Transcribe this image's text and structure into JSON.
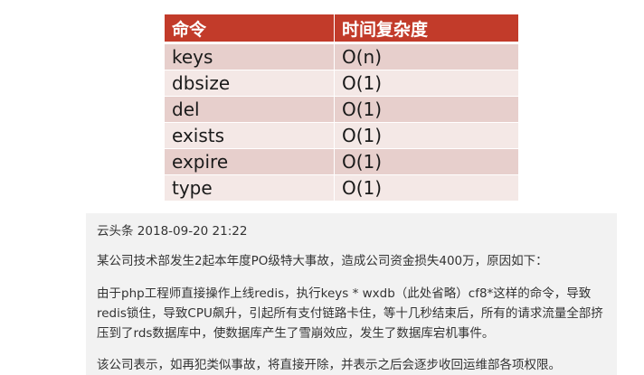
{
  "table": {
    "headers": [
      "命令",
      "时间复杂度"
    ],
    "rows": [
      [
        "keys",
        "O(n)"
      ],
      [
        "dbsize",
        "O(1)"
      ],
      [
        "del",
        "O(1)"
      ],
      [
        "exists",
        "O(1)"
      ],
      [
        "expire",
        "O(1)"
      ],
      [
        "type",
        "O(1)"
      ]
    ]
  },
  "article": {
    "source": "云头条",
    "datetime": "2018-09-20 21:22",
    "paragraphs": [
      "某公司技术部发生2起本年度PO级特大事故，造成公司资金损失400万，原因如下：",
      "由于php工程师直接操作上线redis，执行keys * wxdb（此处省略）cf8*这样的命令，导致redis锁住，导致CPU飙升，引起所有支付链路卡住，等十几秒结束后，所有的请求流量全部挤压到了rds数据库中，使数据库产生了雪崩效应，发生了数据库宕机事件。",
      "该公司表示，如再犯类似事故，将直接开除，并表示之后会逐步收回运维部各项权限。"
    ]
  },
  "colors": {
    "header_bg": "#c23b2a",
    "row_dark": "#e7cfcc",
    "row_light": "#f4e8e6",
    "article_bg": "#f2f2f2"
  }
}
